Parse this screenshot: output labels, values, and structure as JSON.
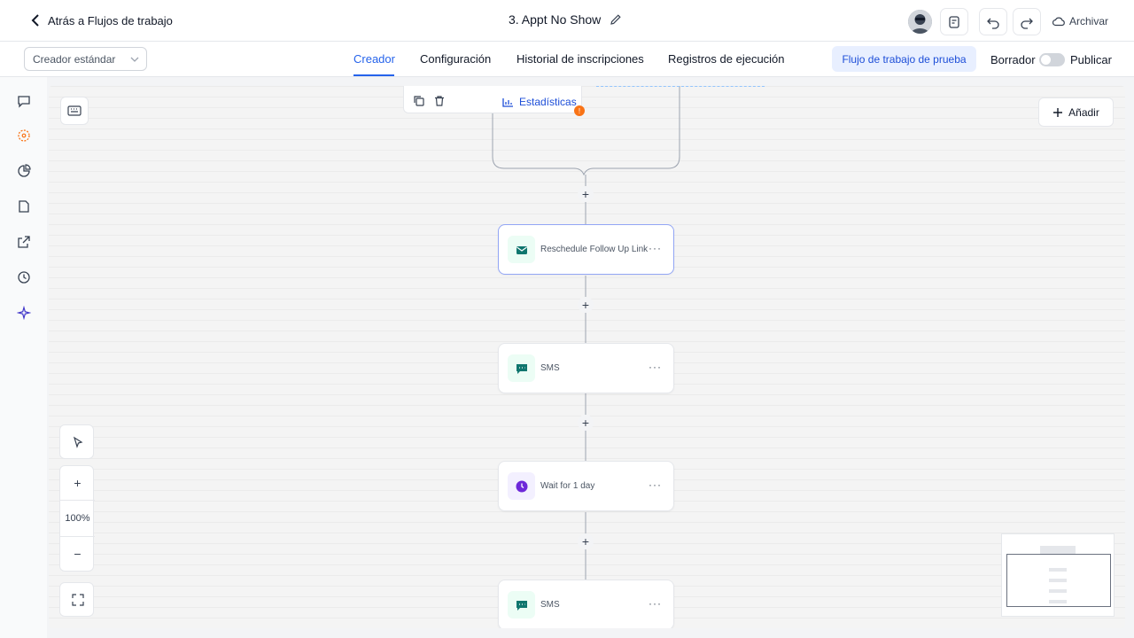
{
  "header": {
    "back_label": "Atrás a Flujos de trabajo",
    "title": "3. Appt No Show",
    "archive_label": "Archivar"
  },
  "subbar": {
    "builder_select": "Creador estándar",
    "tabs": [
      {
        "label": "Creador",
        "active": true
      },
      {
        "label": "Configuración",
        "active": false
      },
      {
        "label": "Historial de inscripciones",
        "active": false
      },
      {
        "label": "Registros de ejecución",
        "active": false
      }
    ],
    "test_button": "Flujo de trabajo de prueba",
    "draft_label": "Borrador",
    "publish_label": "Publicar",
    "publish_toggle_on": false
  },
  "sidebar": {
    "icons": [
      "chat-icon",
      "settings-icon",
      "pie-chart-icon",
      "file-icon",
      "external-link-icon",
      "history-icon",
      "sparkles-icon"
    ]
  },
  "canvas": {
    "add_button": "Añadir",
    "node_toolbar": {
      "stats_label": "Estadísticas",
      "warning_badge": "!"
    },
    "nodes": [
      {
        "label": "Reschedule Follow Up Link",
        "icon": "mail-icon",
        "selected": true
      },
      {
        "label": "SMS",
        "icon": "sms-icon",
        "selected": false
      },
      {
        "label": "Wait for 1 day",
        "icon": "clock-icon",
        "selected": false
      },
      {
        "label": "SMS",
        "icon": "sms-icon",
        "selected": false
      }
    ],
    "zoom": "100%",
    "colors": {
      "accent": "#2563eb",
      "action_green": "#0f766e",
      "wait_purple": "#6d28d9"
    }
  }
}
